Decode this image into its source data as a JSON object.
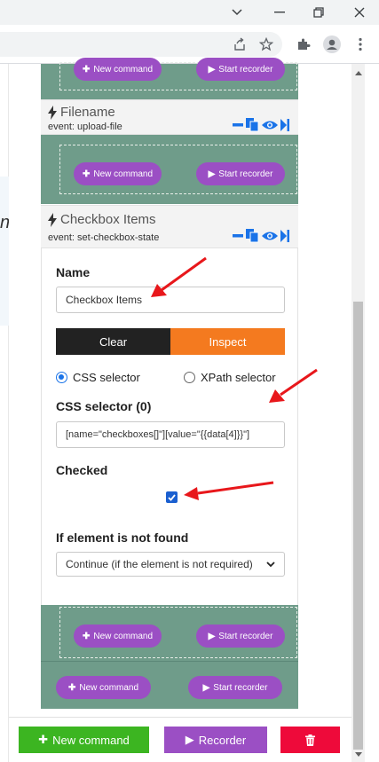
{
  "browser": {
    "window_controls": [
      "chevron-down-icon",
      "minimize-icon",
      "restore-icon",
      "close-icon"
    ],
    "toolbar_icons": [
      "share-icon",
      "star-icon",
      "extension-icon",
      "profile-icon",
      "more-icon"
    ]
  },
  "sections": {
    "top_group": {
      "new_command": "New command",
      "start_recorder": "Start recorder"
    },
    "filename": {
      "title": "Filename",
      "event": "event: upload-file"
    },
    "filename_group": {
      "new_command": "New command",
      "start_recorder": "Start recorder"
    },
    "checkbox_items": {
      "title": "Checkbox Items",
      "event": "event: set-checkbox-state"
    }
  },
  "form": {
    "name_label": "Name",
    "name_value": "Checkbox Items",
    "clear_label": "Clear",
    "inspect_label": "Inspect",
    "css_radio_label": "CSS selector",
    "xpath_radio_label": "XPath selector",
    "selected_mode": "CSS selector",
    "selector_label": "CSS selector (0)",
    "selector_value": "[name=\"checkboxes[]\"][value=\"{{data[4]}}\"]",
    "checked_label": "Checked",
    "checked_value": true,
    "not_found_label": "If element is not found",
    "not_found_value": "Continue (if the element is not required)"
  },
  "lower_groups": {
    "inner": {
      "new_command": "New command",
      "start_recorder": "Start recorder"
    },
    "outer": {
      "new_command": "New command",
      "start_recorder": "Start recorder"
    }
  },
  "footer": {
    "new_command": "New command",
    "recorder": "Recorder",
    "delete_icon": "trash-icon"
  },
  "colors": {
    "group_bg": "#6f9c8a",
    "pill_purple": "#9b4fc4",
    "action_blue": "#1a73e8",
    "clear_bg": "#222222",
    "inspect_bg": "#f47a1f",
    "footer_green": "#3cb521",
    "footer_purple": "#9b4fc4",
    "footer_red": "#ee0a3a",
    "annotation_red": "#e8171b"
  }
}
